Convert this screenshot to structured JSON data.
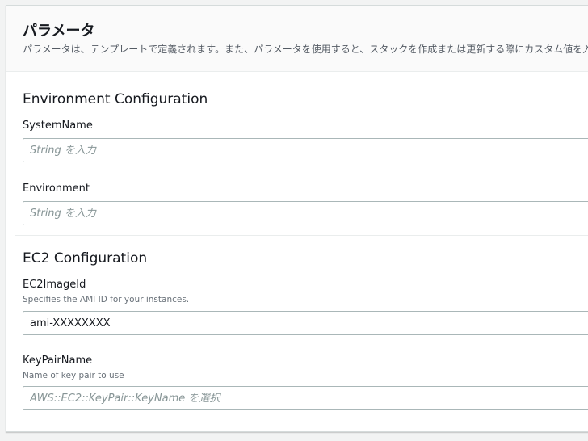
{
  "parameters": {
    "title": "パラメータ",
    "description": "パラメータは、テンプレートで定義されます。また、パラメータを使用すると、スタックを作成または更新する際にカスタム値を入"
  },
  "sections": {
    "environment": {
      "title": "Environment Configuration",
      "system_name": {
        "label": "SystemName",
        "value": "",
        "placeholder": "String を入力"
      },
      "environment": {
        "label": "Environment",
        "value": "",
        "placeholder": "String を入力"
      }
    },
    "ec2": {
      "title": "EC2 Configuration",
      "image_id": {
        "label": "EC2ImageId",
        "hint": "Specifies the AMI ID for your instances.",
        "value": "ami-XXXXXXXX",
        "placeholder": ""
      },
      "key_pair": {
        "label": "KeyPairName",
        "hint": "Name of key pair to use",
        "value": "",
        "placeholder": "AWS::EC2::KeyPair::KeyName を選択"
      }
    }
  }
}
